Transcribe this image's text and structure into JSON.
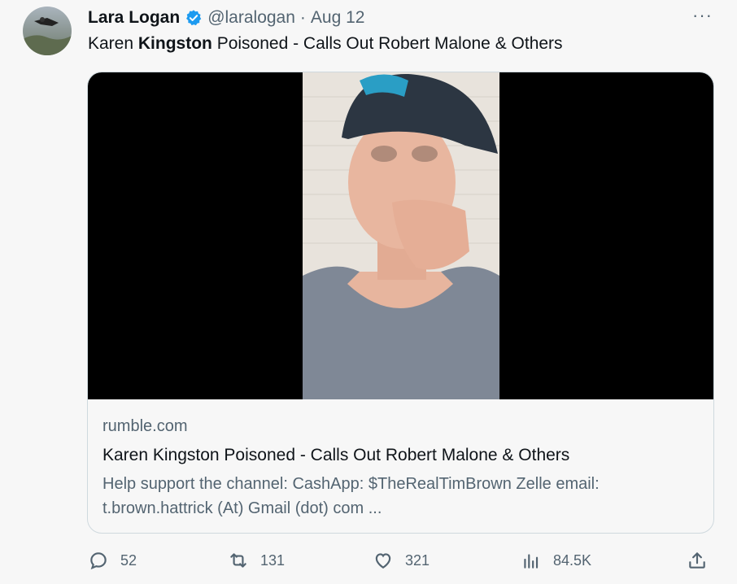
{
  "tweet": {
    "author_name": "Lara Logan",
    "handle": "@laralogan",
    "separator": "·",
    "date": "Aug 12",
    "text_pre": "Karen ",
    "text_bold": "Kingston",
    "text_post": " Poisoned - Calls Out Robert Malone & Others",
    "more_label": "···"
  },
  "card": {
    "domain": "rumble.com",
    "title": "Karen Kingston Poisoned - Calls Out Robert Malone & Others",
    "description": "Help support the channel: CashApp: $TheRealTimBrown Zelle email: t.brown.hattrick (At) Gmail (dot) com ..."
  },
  "actions": {
    "replies": "52",
    "reposts": "131",
    "likes": "321",
    "views": "84.5K"
  },
  "colors": {
    "verified": "#1d9bf0",
    "muted": "#536471",
    "border": "#cfd9de"
  }
}
